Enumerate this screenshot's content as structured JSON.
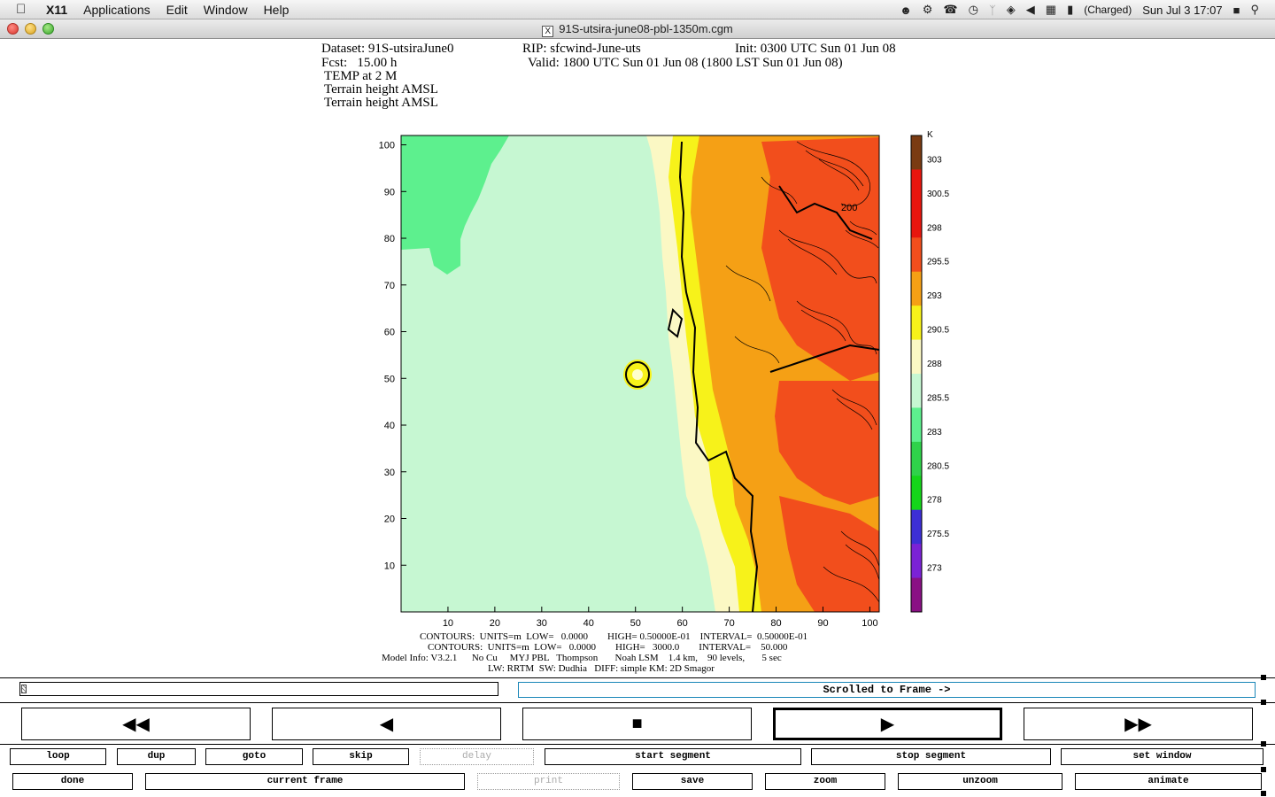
{
  "menubar": {
    "app": "X11",
    "items": [
      "Applications",
      "Edit",
      "Window",
      "Help"
    ],
    "battery": "(Charged)",
    "clock": "Sun Jul 3  17:07"
  },
  "window": {
    "title": "91S-utsira-june08-pbl-1350m.cgm"
  },
  "plot": {
    "header_line1_left": "Dataset: 91S-utsiraJune0",
    "header_line1_mid": "RIP: sfcwind-June-uts",
    "header_line1_right": "Init: 0300 UTC Sun 01 Jun 08",
    "header_line2_left": "Fcst:   15.00 h",
    "header_line2_right": "Valid: 1800 UTC Sun 01 Jun 08 (1800 LST Sun 01 Jun 08)",
    "header_line3": "TEMP at 2 M",
    "header_line4": "Terrain height AMSL",
    "header_line5": "Terrain height AMSL",
    "contour_label": "200",
    "x_ticks": [
      "10",
      "20",
      "30",
      "40",
      "50",
      "60",
      "70",
      "80",
      "90",
      "100"
    ],
    "y_ticks": [
      "10",
      "20",
      "30",
      "40",
      "50",
      "60",
      "70",
      "80",
      "90",
      "100"
    ],
    "colorbar_unit": "K",
    "colorbar_ticks": [
      "303",
      "300.5",
      "298",
      "295.5",
      "293",
      "290.5",
      "288",
      "285.5",
      "283",
      "280.5",
      "278",
      "275.5",
      "273"
    ],
    "colorbar_colors": [
      "#7a3b12",
      "#e8160e",
      "#e8160e",
      "#f24e1c",
      "#f5a015",
      "#f7f21a",
      "#fbf8c4",
      "#c6f7d2",
      "#5df08e",
      "#2fd24a",
      "#15d61a",
      "#3d2fd6",
      "#7b22d6",
      "#8a1184"
    ],
    "footer_line1": "CONTOURS:  UNITS=m  LOW=   0.0000        HIGH= 0.50000E-01    INTERVAL=  0.50000E-01",
    "footer_line2": "CONTOURS:  UNITS=m  LOW=   0.0000        HIGH=   3000.0        INTERVAL=    50.000",
    "footer_line3": "Model Info: V3.2.1      No Cu     MYJ PBL   Thompson       Noah LSM    1.4 km,    90 levels,       5 sec",
    "footer_line4": "LW: RRTM  SW: Dudhia   DIFF: simple KM: 2D Smagor"
  },
  "controls": {
    "status": "Scrolled to Frame ->",
    "row1": [
      "loop",
      "dup",
      "goto",
      "skip",
      "delay",
      "start segment",
      "stop segment",
      "set window"
    ],
    "row2": [
      "done",
      "current frame",
      "print",
      "save",
      "zoom",
      "unzoom",
      "animate"
    ]
  }
}
